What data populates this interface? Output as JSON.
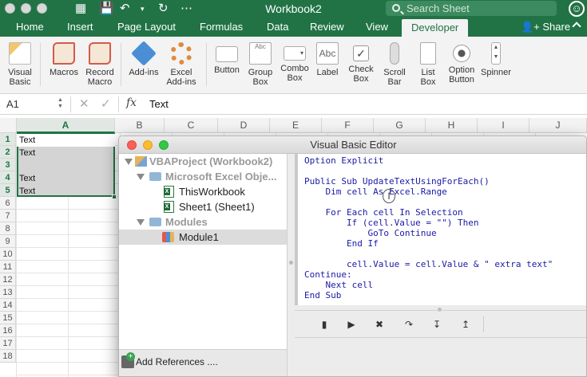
{
  "window": {
    "title": "Workbook2"
  },
  "search": {
    "placeholder": "Search Sheet"
  },
  "tabs": [
    "Home",
    "Insert",
    "Page Layout",
    "Formulas",
    "Data",
    "Review",
    "View",
    "Developer"
  ],
  "active_tab": "Developer",
  "share_label": "Share",
  "ribbon": {
    "visual_basic": "Visual\nBasic",
    "macros": "Macros",
    "record_macro": "Record\nMacro",
    "add_ins": "Add-ins",
    "excel_add_ins": "Excel\nAdd-ins",
    "button": "Button",
    "group_box": "Group\nBox",
    "combo_box": "Combo\nBox",
    "label": "Label",
    "check_box": "Check\nBox",
    "scroll_bar": "Scroll\nBar",
    "list_box": "List\nBox",
    "option_button": "Option\nButton",
    "spinner": "Spinner"
  },
  "formula_bar": {
    "name_box": "A1",
    "fx": "fx",
    "value": "Text"
  },
  "columns": [
    "A",
    "B",
    "C",
    "D",
    "E",
    "F",
    "G",
    "H",
    "I",
    "J"
  ],
  "rows": [
    "1",
    "2",
    "3",
    "4",
    "5",
    "6",
    "7",
    "8",
    "9",
    "10",
    "11",
    "12",
    "13",
    "14",
    "15",
    "16",
    "17",
    "18"
  ],
  "cells_a": [
    "Text",
    "Text",
    "",
    "Text",
    "Text"
  ],
  "vbe": {
    "title": "Visual Basic Editor",
    "tree": {
      "project": "VBAProject (Workbook2)",
      "objects_folder": "Microsoft Excel Obje...",
      "this_workbook": "ThisWorkbook",
      "sheet1": "Sheet1 (Sheet1)",
      "modules_folder": "Modules",
      "module1": "Module1"
    },
    "code": "Option Explicit\n\nPublic Sub UpdateTextUsingForEach()\n    Dim cell As Excel.Range\n\n    For Each cell In Selection\n        If (cell.Value = \"\") Then\n            GoTo Continue\n        End If\n\n        cell.Value = cell.Value & \" extra text\"\nContinue:\n    Next cell\nEnd Sub",
    "add_references": "Add References ...."
  },
  "colors": {
    "excel_green": "#217346",
    "code_blue": "#1a1aa6"
  }
}
